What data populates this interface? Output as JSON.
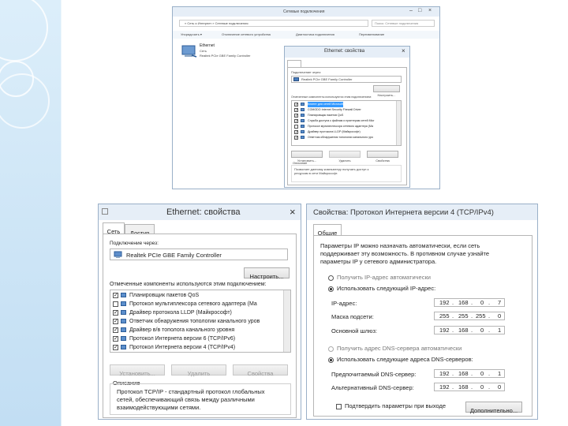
{
  "network_connections": {
    "title": "Сетевые подключения",
    "address": "« Сеть и Интернет » Сетевые подключения",
    "search_placeholder": "Поиск: Сетевые подключения",
    "toolbar": [
      "Упорядочить ▾",
      "Отключение сетевого устройства",
      "Диагностика подключения",
      "Переименование"
    ],
    "adapter": {
      "name": "Ethernet",
      "status": "Сеть",
      "device": "Realtek PCIe GBE Family Controller"
    }
  },
  "small_props": {
    "title": "Ethernet: свойства",
    "tab": "Сеть",
    "connect_via_label": "Подключение через:",
    "adapter": "Realtek PCIe GBE Family Controller",
    "configure_button": "Настроить...",
    "components_label": "Отмеченные компоненты используются этим подключением:",
    "components": [
      {
        "label": "Клиент для сетей Microsoft",
        "checked": true,
        "selected": true
      },
      {
        "label": "COMODO Internet Security Firewall Driver",
        "checked": true,
        "selected": false
      },
      {
        "label": "Планировщик пакетов QoS",
        "checked": true,
        "selected": false
      },
      {
        "label": "Служба доступа к файлам и принтерам сетей Micr",
        "checked": true,
        "selected": false
      },
      {
        "label": "Протокол мультиплексора сетевого адаптера (Ma",
        "checked": false,
        "selected": false
      },
      {
        "label": "Драйвер протокола LLDP (Майкрософт)",
        "checked": true,
        "selected": false
      },
      {
        "label": "Ответчик обнаружения топологии канального уро",
        "checked": true,
        "selected": false
      }
    ],
    "buttons": [
      "Установить...",
      "Удалить",
      "Свойства"
    ],
    "description_label": "Описание",
    "description": "Позволяет данному компьютеру получать доступ к ресурсам в сети Майкрософт."
  },
  "ethernet_props": {
    "title": "Ethernet: свойства",
    "tabs": [
      "Сеть",
      "Доступ"
    ],
    "connect_via_label": "Подключение через:",
    "adapter": "Realtek PCIe GBE Family Controller",
    "configure_button": "Настроить...",
    "components_label": "Отмеченные компоненты используются этим подключением:",
    "components": [
      {
        "label": "Планировщик пакетов QoS",
        "checked": true
      },
      {
        "label": "Протокол мультиплексора сетевого адаптера (Ма",
        "checked": false
      },
      {
        "label": "Драйвер протокола LLDP (Майкрософт)",
        "checked": true
      },
      {
        "label": "Ответчик обнаружения топологии канального уров",
        "checked": true
      },
      {
        "label": "Драйвер в/в тополога канального уровня",
        "checked": true
      },
      {
        "label": "Протокол Интернета версии 6 (TCP/IPv6)",
        "checked": true
      },
      {
        "label": "Протокол Интернета версии 4 (TCP/IPv4)",
        "checked": true
      }
    ],
    "buttons": [
      "Установить...",
      "Удалить",
      "Свойства"
    ],
    "description_label": "Описание",
    "description_line1": "Протокол TCP/IP - стандартный протокол глобальных",
    "description_line2": "сетей, обеспечивающий связь между различными",
    "description_line3": "взаимодействующими сетями."
  },
  "ipv4_props": {
    "title": "Свойства: Протокол Интернета версии 4 (TCP/IPv4)",
    "tab": "Общие",
    "intro_line1": "Параметры IP можно назначать автоматически, если сеть",
    "intro_line2": "поддерживает эту возможность. В противном случае узнайте",
    "intro_line3": "параметры IP у сетевого администратора.",
    "auto_ip": "Получить IP-адрес автоматически",
    "manual_ip": "Использовать следующий IP-адрес:",
    "ip_label": "IP-адрес:",
    "ip_value": [
      "192",
      "168",
      "0",
      "7"
    ],
    "mask_label": "Маска подсети:",
    "mask_value": [
      "255",
      "255",
      "255",
      "0"
    ],
    "gateway_label": "Основной шлюз:",
    "gateway_value": [
      "192",
      "168",
      "0",
      "1"
    ],
    "auto_dns": "Получить адрес DNS-сервера автоматически",
    "manual_dns": "Использовать следующие адреса DNS-серверов:",
    "preferred_dns_label": "Предпочитаемый DNS-сервер:",
    "preferred_dns_value": [
      "192",
      "168",
      "0",
      "1"
    ],
    "alternate_dns_label": "Альтернативный DNS-сервер:",
    "alternate_dns_value": [
      "192",
      "168",
      "0",
      "0"
    ],
    "validate_label": "Подтвердить параметры при выходе",
    "advanced_button": "Дополнительно..."
  },
  "colors": {
    "accent": "#2f6fb6",
    "titlebar": "#e6eef7",
    "slide_bg": "#cfe6f6",
    "selection": "#3399ff"
  }
}
